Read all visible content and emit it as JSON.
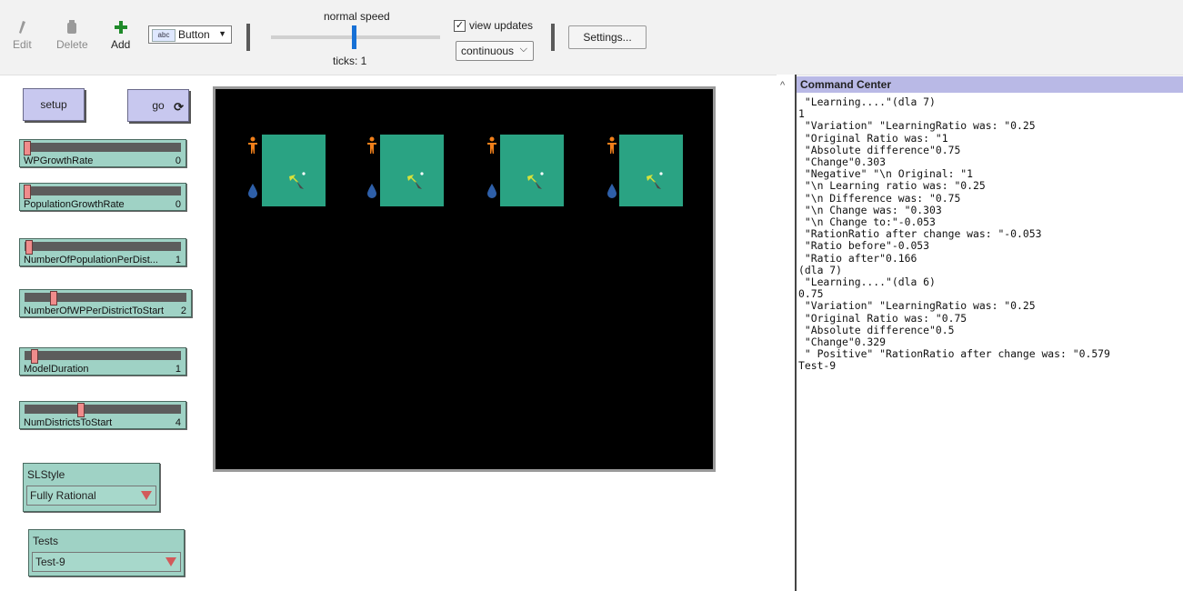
{
  "toolbar": {
    "edit_label": "Edit",
    "delete_label": "Delete",
    "add_label": "Add",
    "widget_type": "Button",
    "speed_label": "normal speed",
    "ticks_label": "ticks: 1",
    "view_updates_label": "view updates",
    "view_updates_checked": true,
    "update_mode": "continuous",
    "settings_label": "Settings..."
  },
  "buttons": {
    "setup": "setup",
    "go": "go"
  },
  "sliders": [
    {
      "name": "WPGrowthRate",
      "value": "0",
      "fraction": 0.0
    },
    {
      "name": "PopulationGrowthRate",
      "value": "0",
      "fraction": 0.0
    },
    {
      "name": "NumberOfPopulationPerDist...",
      "value": "1",
      "fraction": 0.0
    },
    {
      "name": "NumberOfWPPerDistrictToStart",
      "value": "2",
      "fraction": 0.15
    },
    {
      "name": "ModelDuration",
      "value": "1",
      "fraction": 0.0
    },
    {
      "name": "NumDistrictsToStart",
      "value": "4",
      "fraction": 0.33
    }
  ],
  "choosers": {
    "slstyle": {
      "name": "SLStyle",
      "value": "Fully Rational"
    },
    "tests": {
      "name": "Tests",
      "value": "Test-9"
    }
  },
  "colors": {
    "patch": "#2aa383",
    "person": "#f07f1a",
    "drop": "#2e5fa8",
    "arrow": "#d8e23a"
  },
  "command_center": {
    "title": "Command Center",
    "output": " \"Learning....\"(dla 7)\n1\n \"Variation\" \"LearningRatio was: \"0.25\n \"Original Ratio was: \"1\n \"Absolute difference\"0.75\n \"Change\"0.303\n \"Negative\" \"\\n Original: \"1\n \"\\n Learning ratio was: \"0.25\n \"\\n Difference was: \"0.75\n \"\\n Change was: \"0.303\n \"\\n Change to:\"-0.053\n \"RationRatio after change was: \"-0.053\n \"Ratio before\"-0.053\n \"Ratio after\"0.166\n(dla 7)\n \"Learning....\"(dla 6)\n0.75\n \"Variation\" \"LearningRatio was: \"0.25\n \"Original Ratio was: \"0.75\n \"Absolute difference\"0.5\n \"Change\"0.329\n \" Positive\" \"RationRatio after change was: \"0.579\nTest-9"
  }
}
